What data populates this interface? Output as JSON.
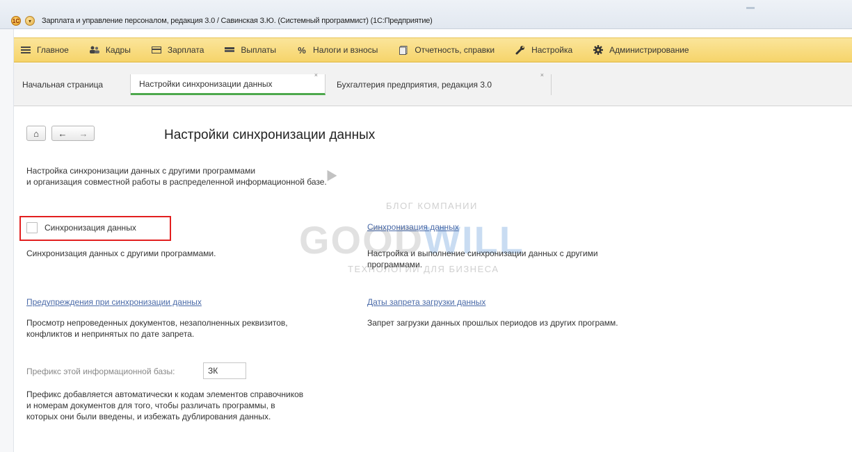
{
  "window": {
    "title": "Зарплата и управление персоналом, редакция 3.0 / Савинская З.Ю. (Системный программист) (1С:Предприятие)",
    "app_icon": "1c-logo-icon",
    "menu_icon": "chevron-down-icon"
  },
  "main_menu": {
    "items": [
      {
        "label": "Главное",
        "icon": "hamburger-icon"
      },
      {
        "label": "Кадры",
        "icon": "people-icon"
      },
      {
        "label": "Зарплата",
        "icon": "wallet-icon"
      },
      {
        "label": "Выплаты",
        "icon": "cash-icon"
      },
      {
        "label": "Налоги и взносы",
        "icon": "percent-icon"
      },
      {
        "label": "Отчетность, справки",
        "icon": "report-icon"
      },
      {
        "label": "Настройка",
        "icon": "wrench-icon"
      },
      {
        "label": "Администрирование",
        "icon": "gear-icon"
      }
    ]
  },
  "tabs": [
    {
      "label": "Начальная страница",
      "active": false,
      "closable": false
    },
    {
      "label": "Настройки синхронизации данных",
      "active": true,
      "closable": true
    },
    {
      "label": "Бухгалтерия предприятия, редакция 3.0",
      "active": false,
      "closable": true
    }
  ],
  "nav": {
    "home": "⌂",
    "back": "←",
    "forward": "→"
  },
  "page": {
    "title": "Настройки синхронизации данных",
    "intro_line1": "Настройка синхронизации данных с другими программами",
    "intro_line2": "и организация совместной работы в распределенной информационной базе.",
    "sync_checkbox_label": "Синхронизация данных",
    "sync_checkbox_checked": false,
    "sync_desc": "Синхронизация данных с другими программами.",
    "sync_link": "Синхронизация данных",
    "sync_link_desc_line1": "Настройка и выполнение синхронизации данных с другими",
    "sync_link_desc_line2": "программами.",
    "warnings_link": "Предупреждения при синхронизации данных",
    "warnings_desc_line1": "Просмотр непроведенных документов, незаполненных реквизитов,",
    "warnings_desc_line2": "конфликтов и непринятых по дате запрета.",
    "ban_dates_link": "Даты запрета загрузки данных",
    "ban_dates_desc": "Запрет загрузки данных прошлых периодов из других программ.",
    "prefix_label": "Префикс этой информационной базы:",
    "prefix_value": "ЗК",
    "prefix_desc_line1": "Префикс добавляется автоматически к кодам элементов справочников",
    "prefix_desc_line2": "и номерам документов для того, чтобы различать программы, в",
    "prefix_desc_line3": "которых они были введены, и избежать дублирования данных."
  },
  "watermark": {
    "top": "БЛОГ КОМПАНИИ",
    "brand_part1": "GOOD",
    "brand_part2": "WILL",
    "bottom": "ТЕХНОЛОГИИ ДЛЯ БИЗНЕСА"
  },
  "colors": {
    "menu_bar": "#f6d46a",
    "active_tab_underline": "#4da84c",
    "link": "#4a6aa8",
    "highlight": "#e21f1f"
  }
}
